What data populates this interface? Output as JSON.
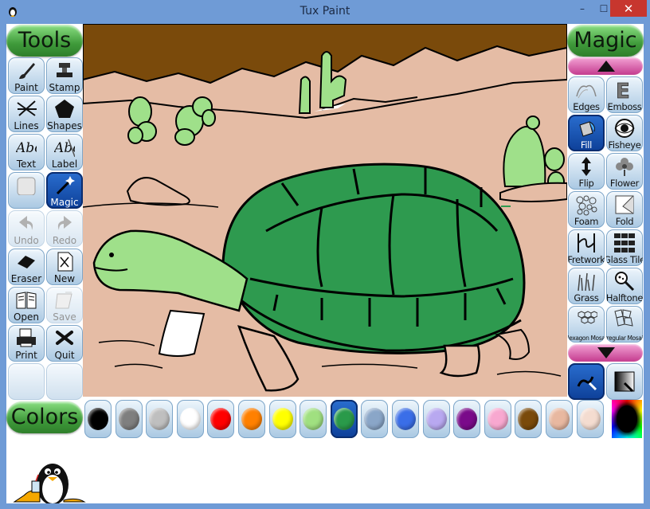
{
  "window": {
    "title": "Tux Paint",
    "controls": {
      "minimize": "–",
      "maximize": "☐",
      "close": "✕"
    }
  },
  "tools_header": "Tools",
  "tools": [
    {
      "label": "Paint",
      "icon": "paintbrush-icon",
      "state": "normal"
    },
    {
      "label": "Stamp",
      "icon": "stamp-icon",
      "state": "normal"
    },
    {
      "label": "Lines",
      "icon": "lines-icon",
      "state": "normal"
    },
    {
      "label": "Shapes",
      "icon": "pentagon-icon",
      "state": "normal"
    },
    {
      "label": "Text",
      "icon": "abc-text-icon",
      "state": "normal"
    },
    {
      "label": "Label",
      "icon": "abc-label-icon",
      "state": "normal"
    },
    {
      "label": "",
      "icon": "blank-icon",
      "state": "normal"
    },
    {
      "label": "Magic",
      "icon": "magic-wand-icon",
      "state": "selected"
    },
    {
      "label": "Undo",
      "icon": "undo-icon",
      "state": "disabled"
    },
    {
      "label": "Redo",
      "icon": "redo-icon",
      "state": "disabled"
    },
    {
      "label": "Eraser",
      "icon": "eraser-icon",
      "state": "normal"
    },
    {
      "label": "New",
      "icon": "new-page-icon",
      "state": "normal"
    },
    {
      "label": "Open",
      "icon": "open-book-icon",
      "state": "normal"
    },
    {
      "label": "Save",
      "icon": "save-icon",
      "state": "disabled"
    },
    {
      "label": "Print",
      "icon": "printer-icon",
      "state": "normal"
    },
    {
      "label": "Quit",
      "icon": "quit-icon",
      "state": "normal"
    }
  ],
  "magic_header": "Magic",
  "magic_tools": [
    {
      "label": "Edges",
      "icon": "edges-icon",
      "state": "normal"
    },
    {
      "label": "Emboss",
      "icon": "emboss-icon",
      "state": "normal"
    },
    {
      "label": "Fill",
      "icon": "fill-bucket-icon",
      "state": "selected"
    },
    {
      "label": "Fisheye",
      "icon": "fisheye-icon",
      "state": "normal"
    },
    {
      "label": "Flip",
      "icon": "flip-icon",
      "state": "normal"
    },
    {
      "label": "Flower",
      "icon": "flower-icon",
      "state": "normal"
    },
    {
      "label": "Foam",
      "icon": "foam-icon",
      "state": "normal"
    },
    {
      "label": "Fold",
      "icon": "fold-icon",
      "state": "normal"
    },
    {
      "label": "Fretwork",
      "icon": "fretwork-icon",
      "state": "normal"
    },
    {
      "label": "Glass Tile",
      "icon": "glass-tile-icon",
      "state": "normal"
    },
    {
      "label": "Grass",
      "icon": "grass-icon",
      "state": "normal"
    },
    {
      "label": "Halftone",
      "icon": "halftone-icon",
      "state": "normal"
    },
    {
      "label": "Hexagon Mosaic",
      "icon": "hexagon-mosaic-icon",
      "state": "normal"
    },
    {
      "label": "Irregular Mosaic",
      "icon": "irregular-mosaic-icon",
      "state": "normal"
    }
  ],
  "magic_options": [
    {
      "icon": "paint-mode-icon",
      "state": "selected"
    },
    {
      "icon": "fullscreen-mode-icon",
      "state": "normal"
    }
  ],
  "colors_header": "Colors",
  "colors": [
    {
      "name": "black",
      "hex": "#000000"
    },
    {
      "name": "gray",
      "hex": "#7f7f7f"
    },
    {
      "name": "light-gray",
      "hex": "#bfbfbf"
    },
    {
      "name": "white",
      "hex": "#ffffff"
    },
    {
      "name": "red",
      "hex": "#ff0000"
    },
    {
      "name": "orange",
      "hex": "#ff8000"
    },
    {
      "name": "yellow",
      "hex": "#ffff00"
    },
    {
      "name": "light-green",
      "hex": "#a0e080"
    },
    {
      "name": "green",
      "hex": "#2a9a4a"
    },
    {
      "name": "slate-blue",
      "hex": "#8aa6c8"
    },
    {
      "name": "blue",
      "hex": "#3a6ee8"
    },
    {
      "name": "lavender",
      "hex": "#b8a8f0"
    },
    {
      "name": "purple",
      "hex": "#7a0a8a"
    },
    {
      "name": "pink",
      "hex": "#f8a8d0"
    },
    {
      "name": "brown",
      "hex": "#7a4a0a"
    },
    {
      "name": "tan",
      "hex": "#e8b8a0"
    },
    {
      "name": "beige",
      "hex": "#f4dcd0"
    }
  ],
  "selected_color": "green",
  "accent": {
    "header_green": "#3f9a3a",
    "selected_blue": "#0d3f98",
    "scroll_pink": "#c43b8e"
  }
}
